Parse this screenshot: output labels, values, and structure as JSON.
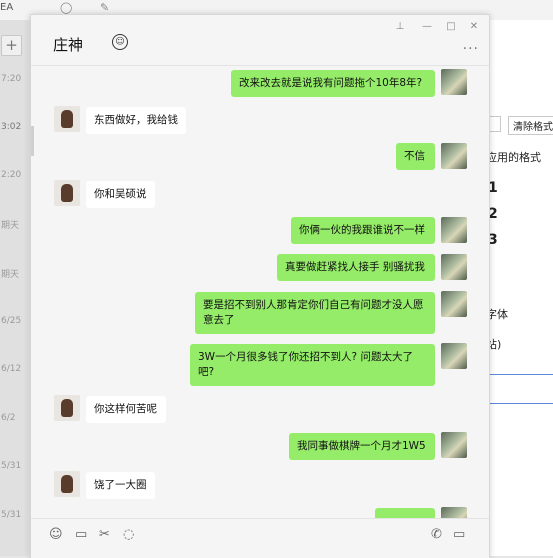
{
  "background": {
    "topbar_fragment": "EA",
    "times": [
      "7:20",
      "3:02",
      "2:20",
      "期天",
      "期天",
      "6/25",
      "6/12",
      "6/2",
      "5/31",
      "5/31"
    ],
    "right_panel": {
      "clear_format": "清除格式",
      "applied_format": "应用的格式",
      "numbers": [
        "1",
        "2",
        "3"
      ],
      "font_text": "字体",
      "site_text": "站)"
    }
  },
  "chat": {
    "title": "庄神",
    "title_emoji": "☺",
    "messages": [
      {
        "side": "self",
        "text": "改来改去就是说我有问题拖个10年8年?"
      },
      {
        "side": "other",
        "text": "东西做好，我给钱"
      },
      {
        "side": "self",
        "text": "不信"
      },
      {
        "side": "other",
        "text": "你和吴硕说"
      },
      {
        "side": "self",
        "text": "你俩一伙的我跟谁说不一样"
      },
      {
        "side": "self",
        "text": "真要做赶紧找人接手 别骚扰我"
      },
      {
        "side": "self",
        "text": "要是招不到别人那肯定你们自己有问题才没人愿意去了"
      },
      {
        "side": "self",
        "text": "3W一个月很多钱了你还招不到人? 问题太大了吧?"
      },
      {
        "side": "other",
        "text": "你这样何苦呢"
      },
      {
        "side": "self",
        "text": "我同事做棋牌一个月才1W5"
      },
      {
        "side": "other",
        "text": "饶了一大圈"
      }
    ]
  },
  "icons": {
    "pin": "pin-icon",
    "minimize": "minimize-icon",
    "maximize": "maximize-icon",
    "close": "close-icon",
    "more": "more-icon",
    "emoji": "emoji-icon",
    "folder": "folder-icon",
    "scissors": "scissors-icon",
    "chat_bubble": "chat-bubble-icon",
    "phone": "phone-icon",
    "video": "video-icon"
  },
  "colors": {
    "self_bubble": "#95ec69",
    "other_bubble": "#ffffff",
    "window_bg": "#f5f5f5"
  }
}
